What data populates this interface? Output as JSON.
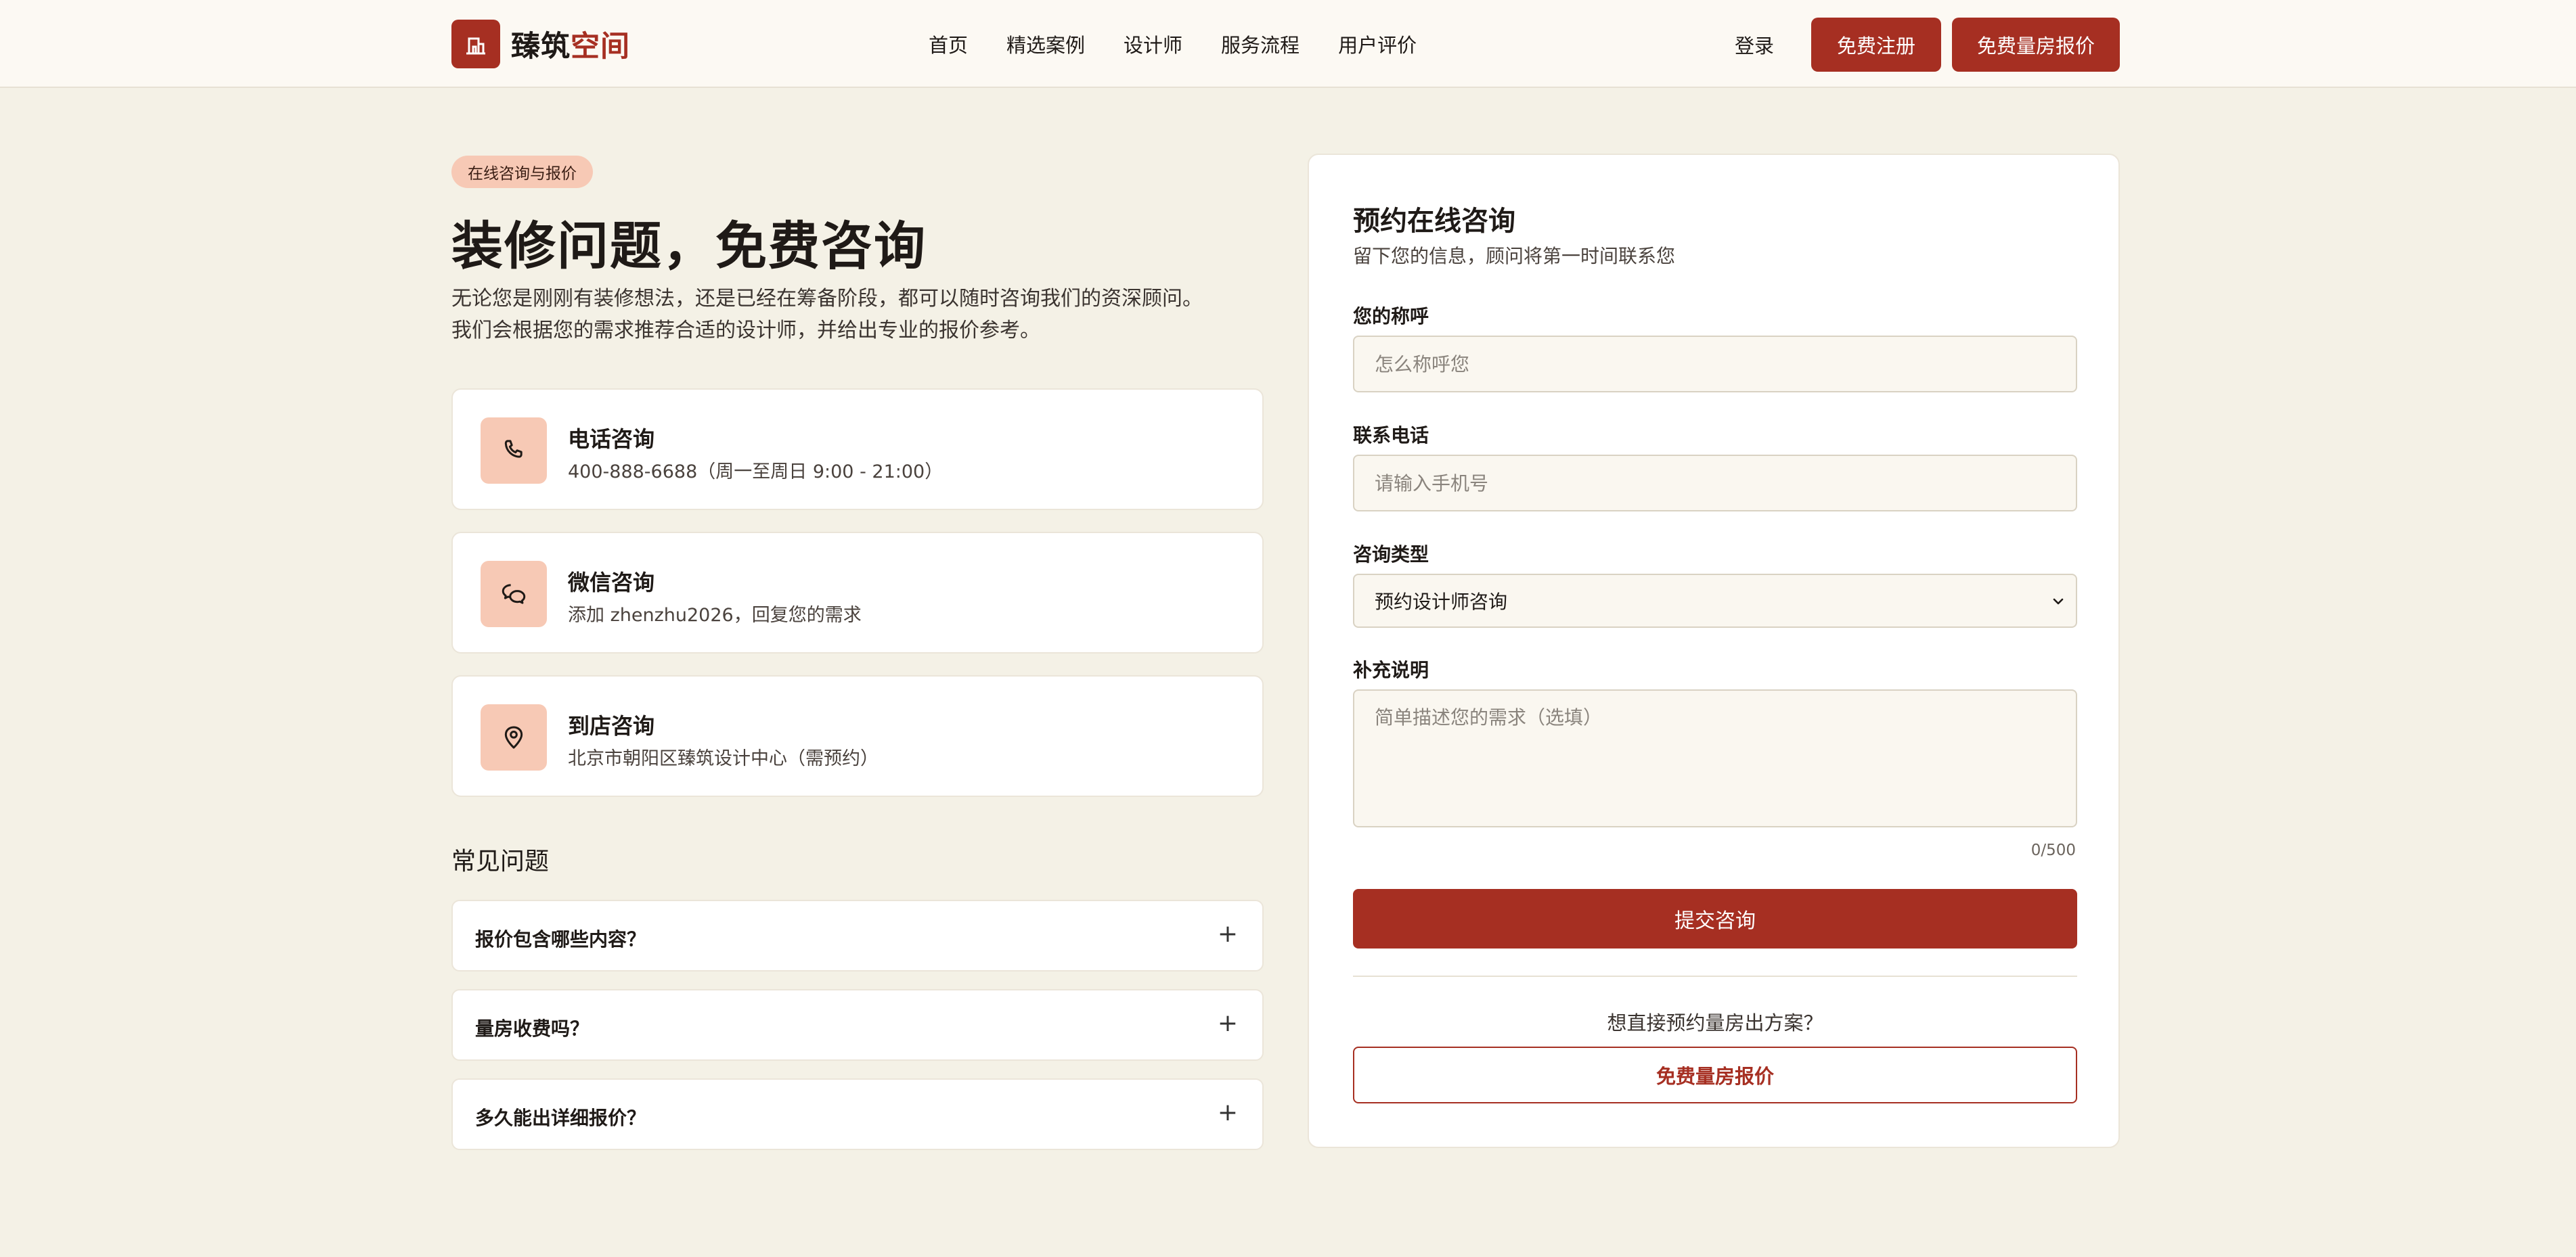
{
  "brand": {
    "name_main": "臻筑",
    "name_accent": "空间",
    "accent_color": "#a62f22"
  },
  "nav": {
    "items": [
      "首页",
      "精选案例",
      "设计师",
      "服务流程",
      "用户评价"
    ]
  },
  "header_actions": {
    "login": "登录",
    "register": "免费注册",
    "quote": "免费量房报价"
  },
  "hero": {
    "tag": "在线咨询与报价",
    "title": "装修问题，免费咨询",
    "desc_line1": "无论您是刚刚有装修想法，还是已经在筹备阶段，都可以随时咨询我们的资深顾问。",
    "desc_line2": "我们会根据您的需求推荐合适的设计师，并给出专业的报价参考。"
  },
  "contacts": [
    {
      "icon": "phone-icon",
      "title": "电话咨询",
      "text": "400-888-6688（周一至周日 9:00 - 21:00）"
    },
    {
      "icon": "wechat-icon",
      "title": "微信咨询",
      "text": "添加 zhenzhu2026，回复您的需求"
    },
    {
      "icon": "location-pin-icon",
      "title": "到店咨询",
      "text": "北京市朝阳区臻筑设计中心（需预约）"
    }
  ],
  "faq": {
    "heading": "常见问题",
    "items": [
      "报价包含哪些内容？",
      "量房收费吗？",
      "多久能出详细报价？"
    ],
    "expand_symbol": "+"
  },
  "form": {
    "title": "预约在线咨询",
    "subtitle": "留下您的信息，顾问将第一时间联系您",
    "name_label": "您的称呼",
    "name_placeholder": "怎么称呼您",
    "phone_label": "联系电话",
    "phone_placeholder": "请输入手机号",
    "type_label": "咨询类型",
    "type_value": "预约设计师咨询",
    "note_label": "补充说明",
    "note_placeholder": "简单描述您的需求（选填）",
    "counter": "0/500",
    "submit": "提交咨询",
    "direct_question": "想直接预约量房出方案？",
    "direct_button": "免费量房报价"
  }
}
